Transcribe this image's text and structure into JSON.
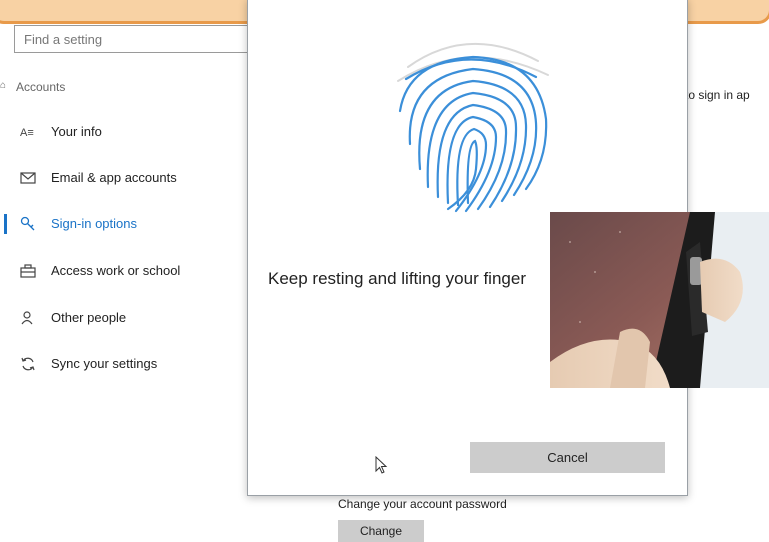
{
  "settings": {
    "search_placeholder": "Find a setting",
    "section_title": "Accounts",
    "nav_items": [
      {
        "label": "Your info",
        "icon": "person-card-icon"
      },
      {
        "label": "Email & app accounts",
        "icon": "mail-icon"
      },
      {
        "label": "Sign-in options",
        "icon": "key-icon",
        "active": true
      },
      {
        "label": "Access work or school",
        "icon": "briefcase-icon"
      },
      {
        "label": "Other people",
        "icon": "person-add-icon"
      },
      {
        "label": "Sync your settings",
        "icon": "sync-icon"
      }
    ],
    "right_partial_text": "to sign in ap",
    "change_password_text": "Change your account password",
    "change_button_label": "Change"
  },
  "dialog": {
    "instruction": "Keep resting and lifting your finger",
    "cancel_label": "Cancel"
  },
  "colors": {
    "accent": "#1a73c7",
    "fingerprint": "#3b8fd9",
    "button_gray": "#cccccc",
    "banner_fill": "#f8d2a4",
    "banner_border": "#e89a4a"
  }
}
